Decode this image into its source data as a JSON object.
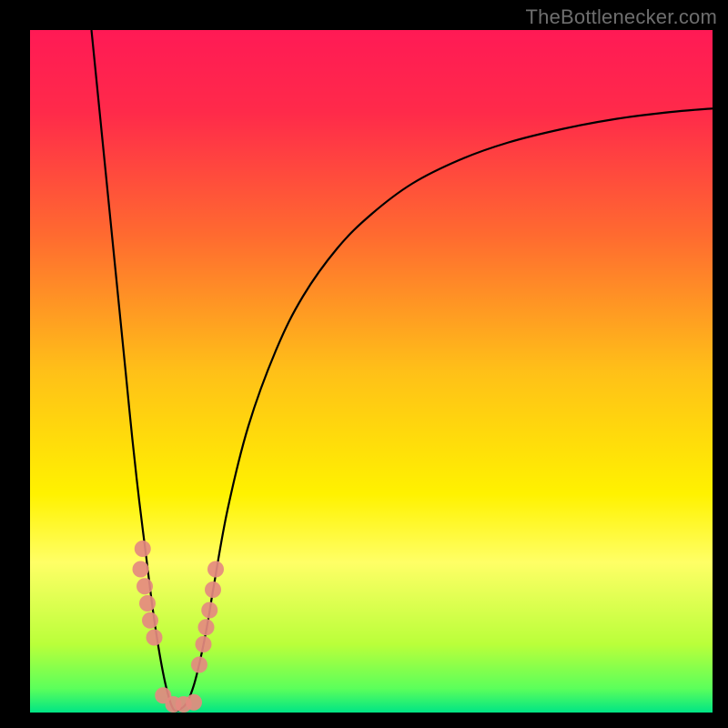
{
  "watermark": {
    "text": "TheBottlenecker.com"
  },
  "chart_data": {
    "type": "line",
    "title": "",
    "xlabel": "",
    "ylabel": "",
    "xlim": [
      0,
      100
    ],
    "ylim": [
      0,
      100
    ],
    "grid": false,
    "legend": false,
    "background_gradient": {
      "stops": [
        {
          "pos": 0.0,
          "color": "#ff1a55"
        },
        {
          "pos": 0.12,
          "color": "#ff2a4a"
        },
        {
          "pos": 0.3,
          "color": "#ff6a30"
        },
        {
          "pos": 0.5,
          "color": "#ffc018"
        },
        {
          "pos": 0.68,
          "color": "#fff200"
        },
        {
          "pos": 0.78,
          "color": "#ffff66"
        },
        {
          "pos": 0.9,
          "color": "#baff3a"
        },
        {
          "pos": 0.965,
          "color": "#5bff5b"
        },
        {
          "pos": 1.0,
          "color": "#00e585"
        }
      ]
    },
    "curve": {
      "x_min_at": 21,
      "points": [
        {
          "x": 9.0,
          "y": 100.0
        },
        {
          "x": 10.0,
          "y": 90.0
        },
        {
          "x": 11.0,
          "y": 80.0
        },
        {
          "x": 12.0,
          "y": 70.0
        },
        {
          "x": 13.0,
          "y": 60.0
        },
        {
          "x": 14.0,
          "y": 50.0
        },
        {
          "x": 15.0,
          "y": 40.0
        },
        {
          "x": 16.0,
          "y": 31.0
        },
        {
          "x": 17.0,
          "y": 23.0
        },
        {
          "x": 18.0,
          "y": 15.0
        },
        {
          "x": 19.0,
          "y": 8.5
        },
        {
          "x": 20.0,
          "y": 3.5
        },
        {
          "x": 21.0,
          "y": 0.5
        },
        {
          "x": 22.0,
          "y": 0.5
        },
        {
          "x": 23.0,
          "y": 1.5
        },
        {
          "x": 24.0,
          "y": 4.0
        },
        {
          "x": 25.0,
          "y": 8.0
        },
        {
          "x": 26.0,
          "y": 13.0
        },
        {
          "x": 27.0,
          "y": 19.0
        },
        {
          "x": 29.0,
          "y": 30.0
        },
        {
          "x": 32.0,
          "y": 42.0
        },
        {
          "x": 36.0,
          "y": 53.0
        },
        {
          "x": 40.0,
          "y": 61.0
        },
        {
          "x": 45.0,
          "y": 68.0
        },
        {
          "x": 50.0,
          "y": 73.0
        },
        {
          "x": 56.0,
          "y": 77.5
        },
        {
          "x": 63.0,
          "y": 81.0
        },
        {
          "x": 70.0,
          "y": 83.5
        },
        {
          "x": 78.0,
          "y": 85.5
        },
        {
          "x": 86.0,
          "y": 87.0
        },
        {
          "x": 94.0,
          "y": 88.0
        },
        {
          "x": 100.0,
          "y": 88.5
        }
      ]
    },
    "marker_clusters": [
      {
        "name": "left-lower",
        "points": [
          {
            "x": 16.5,
            "y": 24.0
          },
          {
            "x": 16.2,
            "y": 21.0
          },
          {
            "x": 16.8,
            "y": 18.5
          },
          {
            "x": 17.2,
            "y": 16.0
          },
          {
            "x": 17.6,
            "y": 13.5
          },
          {
            "x": 18.2,
            "y": 11.0
          }
        ]
      },
      {
        "name": "bottom",
        "points": [
          {
            "x": 19.5,
            "y": 2.5
          },
          {
            "x": 21.0,
            "y": 1.2
          },
          {
            "x": 22.5,
            "y": 1.2
          },
          {
            "x": 24.0,
            "y": 1.5
          }
        ]
      },
      {
        "name": "right-lower",
        "points": [
          {
            "x": 24.8,
            "y": 7.0
          },
          {
            "x": 25.4,
            "y": 10.0
          },
          {
            "x": 25.8,
            "y": 12.5
          },
          {
            "x": 26.3,
            "y": 15.0
          },
          {
            "x": 26.8,
            "y": 18.0
          },
          {
            "x": 27.2,
            "y": 21.0
          }
        ]
      }
    ],
    "marker_style": {
      "r": 9,
      "fill": "#e48a80",
      "opacity": 0.92
    }
  }
}
